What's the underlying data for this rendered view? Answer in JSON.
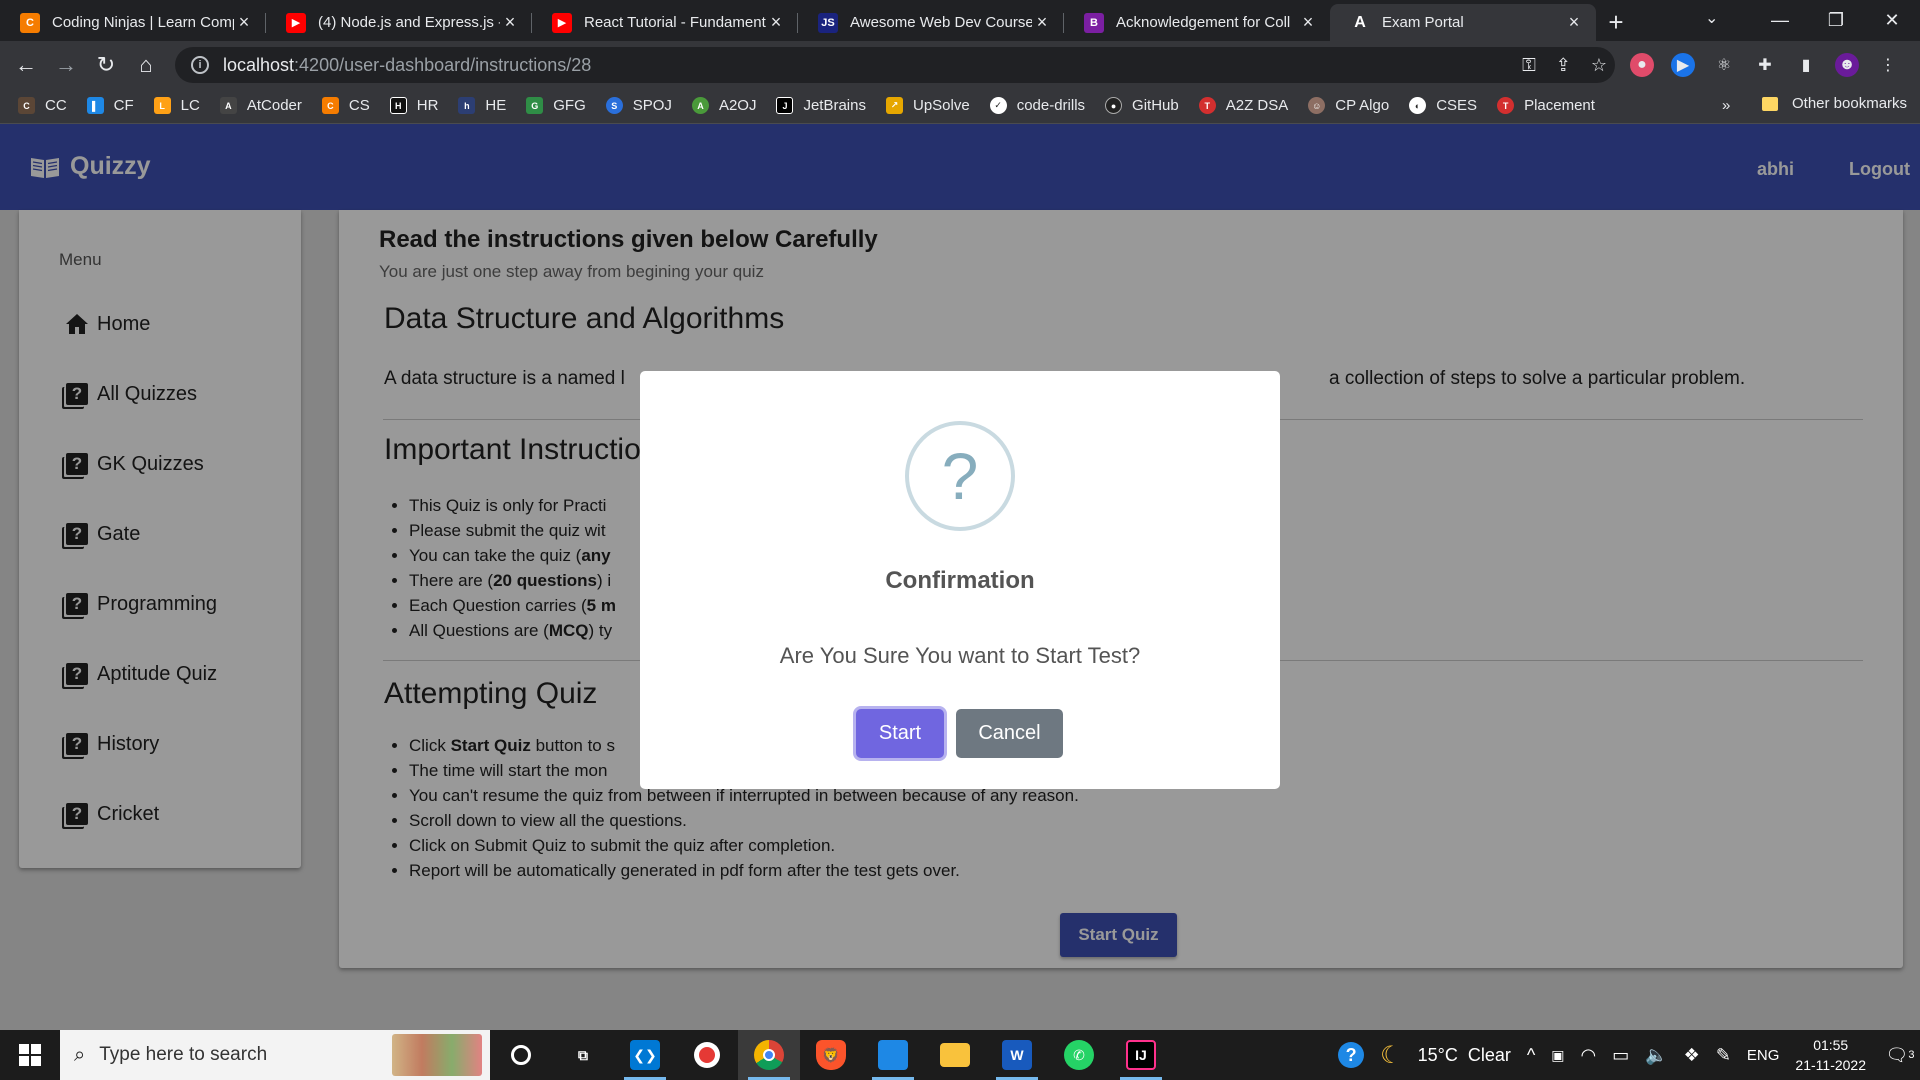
{
  "browser": {
    "tabs": [
      {
        "title": "Coding Ninjas | Learn Comp",
        "icon": "coding-ninjas-icon",
        "color": "#f57c00"
      },
      {
        "title": "(4) Node.js and Express.js -",
        "icon": "youtube-icon",
        "color": "#ff0000"
      },
      {
        "title": "React Tutorial - Fundament",
        "icon": "youtube-icon",
        "color": "#ff0000"
      },
      {
        "title": "Awesome Web Dev Course",
        "icon": "js-icon",
        "color": "#1a237e"
      },
      {
        "title": "Acknowledgement for Coll",
        "icon": "doc-icon",
        "color": "#7b1fa2"
      },
      {
        "title": "Exam Portal",
        "icon": "angular-icon",
        "color": "#35363a"
      }
    ],
    "new_tab": "+",
    "url_host": "localhost",
    "url_path": ":4200/user-dashboard/instructions/28",
    "bookmarks": [
      {
        "label": "CC",
        "color": "#5b4636"
      },
      {
        "label": "CF",
        "color": "#1e88e5"
      },
      {
        "label": "LC",
        "color": "#ffa116"
      },
      {
        "label": "AtCoder",
        "color": "#444"
      },
      {
        "label": "CS",
        "color": "#f57c00"
      },
      {
        "label": "HR",
        "color": "#111"
      },
      {
        "label": "HE",
        "color": "#2c3e73"
      },
      {
        "label": "GFG",
        "color": "#2f8d46"
      },
      {
        "label": "SPOJ",
        "color": "#2a6fdb"
      },
      {
        "label": "A2OJ",
        "color": "#4a9a3a"
      },
      {
        "label": "JetBrains",
        "color": "#000"
      },
      {
        "label": "UpSolve",
        "color": "#e6a700"
      },
      {
        "label": "code-drills",
        "color": "#fff"
      },
      {
        "label": "GitHub",
        "color": "#222"
      },
      {
        "label": "A2Z DSA",
        "color": "#d32f2f"
      },
      {
        "label": "CP Algo",
        "color": "#8d6e63"
      },
      {
        "label": "CSES",
        "color": "#fff"
      },
      {
        "label": "Placement",
        "color": "#d32f2f"
      }
    ],
    "more_bookmarks": "»",
    "other_bookmarks": "Other bookmarks"
  },
  "app": {
    "brand": "Quizzy",
    "user": "abhi",
    "logout": "Logout",
    "menu_title": "Menu",
    "menu": [
      "Home",
      "All Quizzes",
      "GK Quizzes",
      "Gate",
      "Programming",
      "Aptitude Quiz",
      "History",
      "Cricket"
    ]
  },
  "main": {
    "heading": "Read the instructions given below Carefully",
    "subtitle": "You are just one step away from begining your quiz",
    "quiz_title": "Data Structure and Algorithms",
    "desc_left": "A data structure is a named l",
    "desc_right": "a collection of steps to solve a particular problem.",
    "important_title": "Important Instructio",
    "important": [
      {
        "pre": "This Quiz is only for Practi",
        "bold": "",
        "post": ""
      },
      {
        "pre": "Please submit the quiz wit",
        "bold": "",
        "post": ""
      },
      {
        "pre": "You can take the quiz (",
        "bold": "any",
        "post": ""
      },
      {
        "pre": "There are (",
        "bold": "20 questions",
        "post": ") i"
      },
      {
        "pre": "Each Question carries (",
        "bold": "5 m",
        "post": ""
      },
      {
        "pre": "All Questions are (",
        "bold": "MCQ",
        "post": ") ty"
      }
    ],
    "attempting_title": "Attempting Quiz",
    "attempting": [
      {
        "pre": "Click ",
        "bold": "Start Quiz",
        "post": " button to s"
      },
      {
        "pre": "The time will start the mon",
        "bold": "",
        "post": ""
      },
      {
        "pre": "You can't resume the quiz from between if interrupted in between because of any reason.",
        "bold": "",
        "post": ""
      },
      {
        "pre": "Scroll down to view all the questions.",
        "bold": "",
        "post": ""
      },
      {
        "pre": "Click on Submit Quiz to submit the quiz after completion.",
        "bold": "",
        "post": ""
      },
      {
        "pre": "Report will be automatically generated in pdf form after the test gets over.",
        "bold": "",
        "post": ""
      }
    ],
    "start_button": "Start Quiz"
  },
  "dialog": {
    "icon": "?",
    "title": "Confirmation",
    "text": "Are You Sure You want to Start Test?",
    "confirm": "Start",
    "cancel": "Cancel"
  },
  "taskbar": {
    "search_placeholder": "Type here to search",
    "weather": "15°C  Clear",
    "lang": "ENG",
    "time": "01:55",
    "date": "21-11-2022",
    "notifications": "3"
  }
}
